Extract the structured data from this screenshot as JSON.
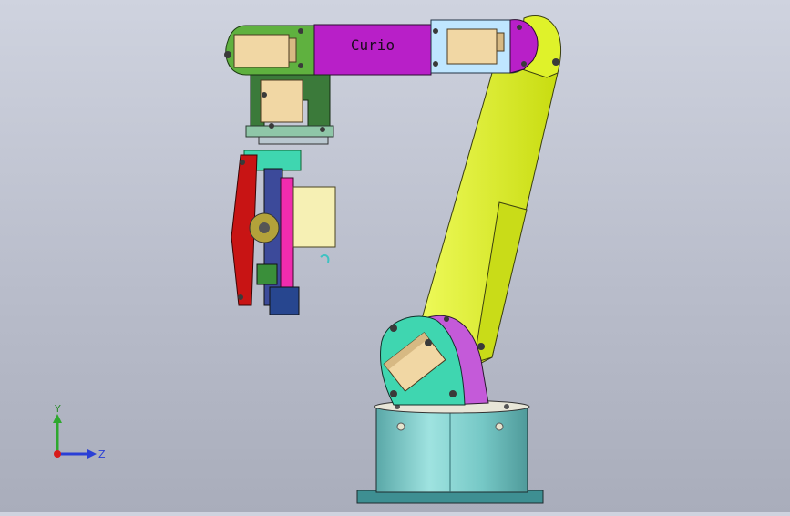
{
  "model": {
    "arm_label": "Curio"
  },
  "triad": {
    "y_label": "Y",
    "z_label": "Z"
  },
  "colors": {
    "background_top": "#cfd3df",
    "background_bottom": "#a9adbb",
    "upper_arm": "#dff22a",
    "forearm_center": "#b81fc8",
    "forearm_left": "#5fb13f",
    "forearm_right": "#bfe6ff",
    "base_cylinder": "#7fd1cf",
    "shoulder_plate": "#3fd6b0",
    "shoulder_cap": "#c45ad9",
    "servo_block": "#f1d7a4",
    "gripper_red": "#c81414",
    "gripper_pink": "#f02cae",
    "triad_y": "#2ea82e",
    "triad_z": "#2a3fd6",
    "triad_x": "#d81c1c"
  },
  "icons": {
    "triad": "coordinate-triad-icon"
  }
}
